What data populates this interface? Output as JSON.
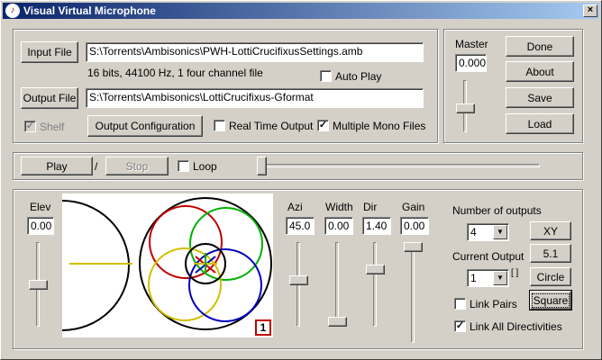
{
  "window": {
    "title": "Visual Virtual Microphone",
    "icon": "microphone-app-icon",
    "close_glyph": "×"
  },
  "file_section": {
    "input_file_button": "Input File",
    "input_path": "S:\\Torrents\\Ambisonics\\PWH-LottiCrucifixusSettings.amb",
    "file_info": "16 bits, 44100 Hz, 1 four channel file",
    "auto_play_label": "Auto Play",
    "auto_play_checked": false,
    "output_file_button": "Output File",
    "output_path": "S:\\Torrents\\Ambisonics\\LottiCrucifixus-Gformat",
    "shelf_label": "Shelf",
    "shelf_checked": true,
    "output_config_button": "Output Configuration",
    "real_time_label": "Real Time Output",
    "real_time_checked": false,
    "multiple_mono_label": "Multiple Mono Files",
    "multiple_mono_checked": true
  },
  "master": {
    "label": "Master",
    "value": "0.000",
    "level": 0.55
  },
  "actions": {
    "done": "Done",
    "about": "About",
    "save": "Save",
    "load": "Load"
  },
  "transport": {
    "play": "Play",
    "separator": "/",
    "stop": "Stop",
    "loop_label": "Loop",
    "loop_checked": false,
    "position": 0
  },
  "elev": {
    "label": "Elev",
    "value": "0.00",
    "level": 0.5
  },
  "params": [
    {
      "label": "Azi",
      "value": "45.0",
      "level": 0.45
    },
    {
      "label": "Width",
      "value": "0.00",
      "level": 1.0
    },
    {
      "label": "Dir",
      "value": "1.40",
      "level": 0.3
    },
    {
      "label": "Gain",
      "value": "0.00",
      "level": 0.0
    }
  ],
  "outputs": {
    "number_label": "Number of outputs",
    "number_value": "4",
    "current_label": "Current Output",
    "current_value": "1",
    "brackets": "[ ]",
    "xy_button": "XY",
    "surround_button": "5.1",
    "circle_button": "Circle",
    "square_button": "Square",
    "link_pairs_label": "Link Pairs",
    "link_pairs_checked": false,
    "link_all_label": "Link All Directivities",
    "link_all_checked": true
  },
  "plot": {
    "badge": "1"
  },
  "colors": {
    "title_start": "#0a246a",
    "title_end": "#a6caf0",
    "mic_red": "#c00000",
    "mic_green": "#00b000",
    "mic_blue": "#0000c0",
    "mic_yellow": "#d0c000"
  }
}
